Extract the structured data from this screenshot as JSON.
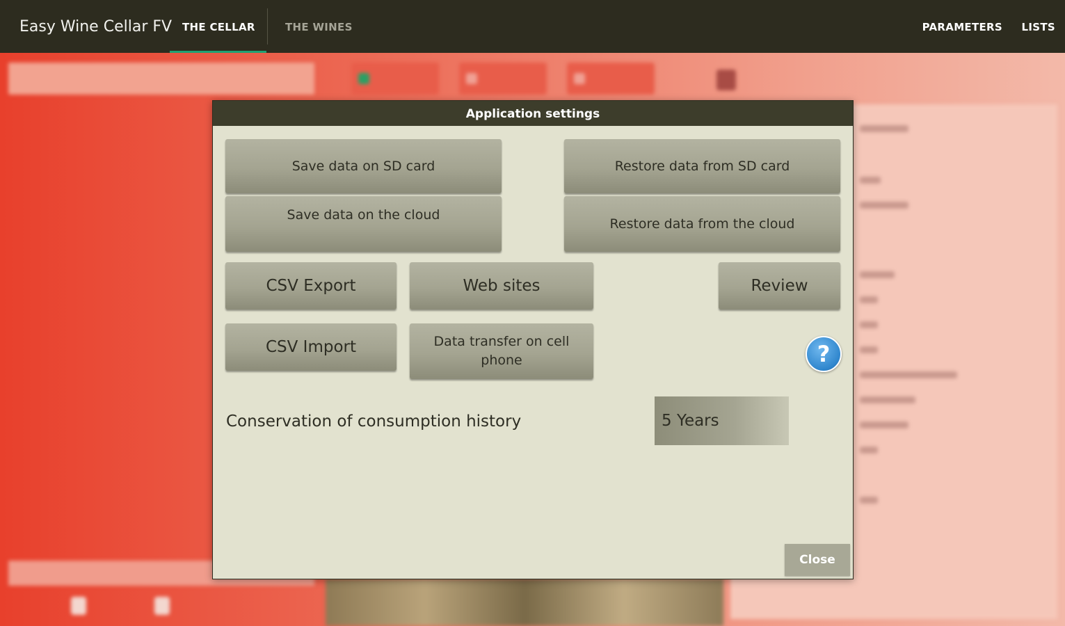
{
  "appbar": {
    "title": "Easy Wine Cellar FV",
    "tabs": [
      "THE CELLAR",
      "THE WINES"
    ],
    "menu": [
      "PARAMETERS",
      "LISTS"
    ]
  },
  "dialog": {
    "title": "Application settings",
    "buttons": {
      "save_sd": "Save data on SD card",
      "restore_sd": "Restore data from SD card",
      "save_cloud": "Save data on the cloud",
      "restore_cloud": "Restore data from the cloud",
      "csv_export": "CSV Export",
      "web_sites": "Web sites",
      "review": "Review",
      "csv_import": "CSV Import",
      "data_transfer": "Data transfer on cell phone"
    },
    "help_glyph": "?",
    "history": {
      "label": "Conservation of consumption history",
      "value": "5 Years"
    },
    "close_label": "Close"
  },
  "icons": [
    "help-icon"
  ],
  "colors": {
    "appbar": "#2d2c1f",
    "tab_indicator": "#1fa173",
    "dialog_bg": "#e2e2cf",
    "dialog_header": "#3d3d2b",
    "button": "#a4a491",
    "help_blue": "#2f86cd"
  }
}
